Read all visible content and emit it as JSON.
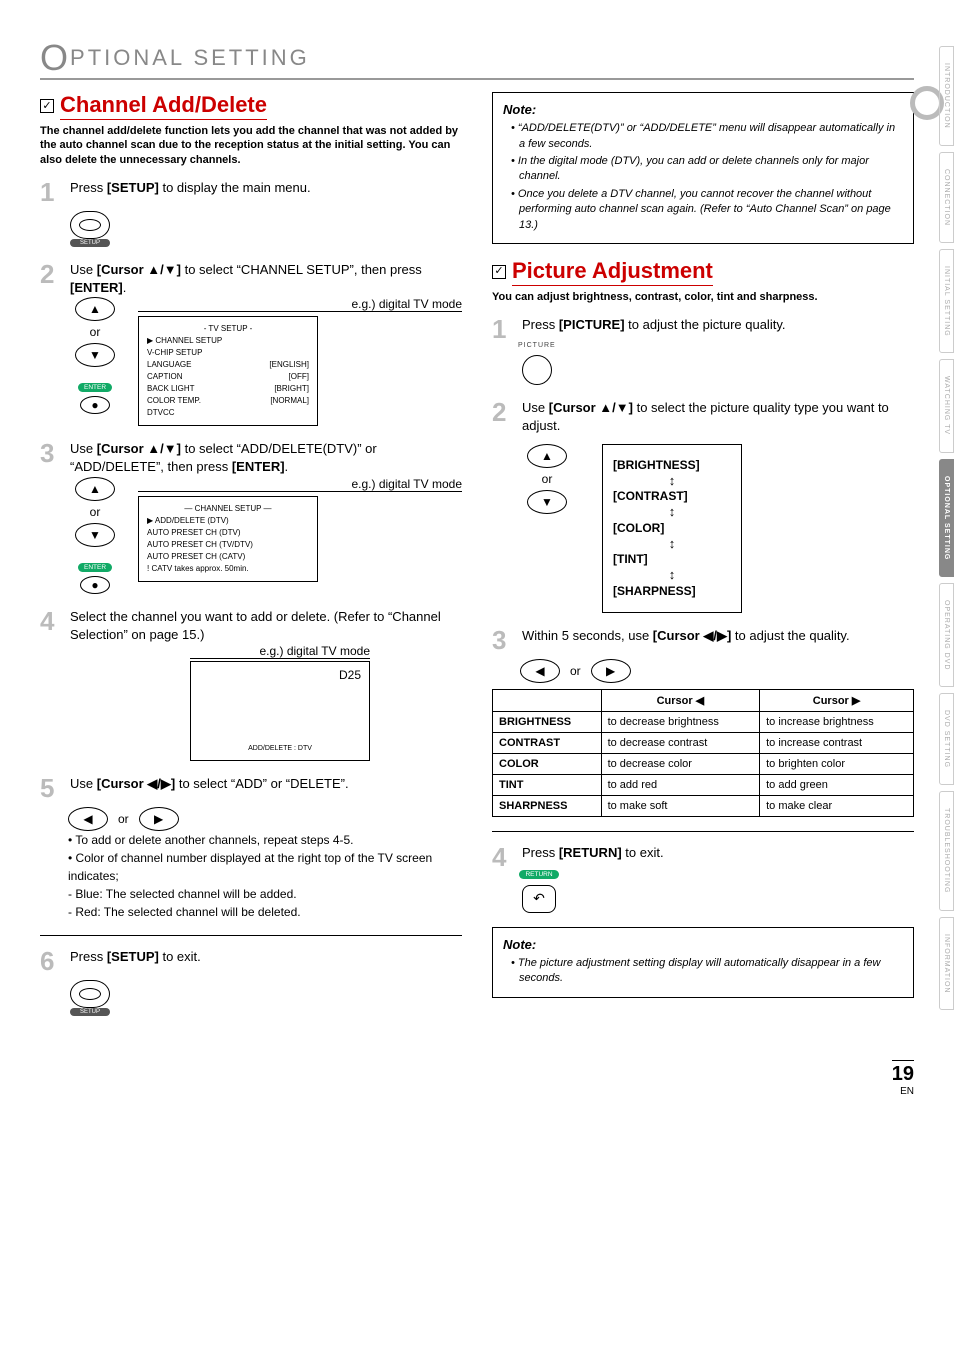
{
  "header": {
    "prefix": "O",
    "title": "PTIONAL  SETTING"
  },
  "sideTabs": [
    "INTRODUCTION",
    "CONNECTION",
    "INITIAL  SETTING",
    "WATCHING  TV",
    "OPTIONAL  SETTING",
    "OPERATING  DVD",
    "DVD  SETTING",
    "TROUBLESHOOTING",
    "INFORMATION"
  ],
  "activeTabIndex": 4,
  "channel": {
    "heading": "Channel Add/Delete",
    "intro": "The channel add/delete function lets you add the channel that was not added by the auto channel scan due to the reception status at the initial setting. You can also delete the unnecessary channels.",
    "step1": {
      "pre": "Press ",
      "btn": "[SETUP]",
      "post": " to display the main menu."
    },
    "setupLabel": "SETUP",
    "step2": {
      "pre": "Use ",
      "btn": "[Cursor ▲/▼]",
      "mid": " to select “CHANNEL SETUP”, then press ",
      "btn2": "[ENTER]",
      "post": "."
    },
    "or": "or",
    "enterLabel": "ENTER",
    "egLabel": "e.g.) digital TV mode",
    "menu1": {
      "title": "-   TV SETUP   -",
      "rows": [
        [
          "▶ CHANNEL SETUP",
          ""
        ],
        [
          "V-CHIP SETUP",
          ""
        ],
        [
          "LANGUAGE",
          "[ENGLISH]"
        ],
        [
          "CAPTION",
          "[OFF]"
        ],
        [
          "BACK LIGHT",
          "[BRIGHT]"
        ],
        [
          "COLOR TEMP.",
          "[NORMAL]"
        ],
        [
          "DTVCC",
          ""
        ]
      ]
    },
    "step3": {
      "pre": "Use ",
      "btn": "[Cursor ▲/▼]",
      "mid": " to select “ADD/DELETE(DTV)” or “ADD/DELETE”, then press ",
      "btn2": "[ENTER]",
      "post": "."
    },
    "menu2": {
      "title": "—  CHANNEL SETUP  —",
      "rows": [
        [
          "▶ ADD/DELETE (DTV)"
        ],
        [
          "AUTO PRESET CH (DTV)"
        ],
        [
          "AUTO PRESET CH (TV/DTV)"
        ],
        [
          "AUTO PRESET CH (CATV)"
        ],
        [
          "! CATV takes approx. 50min."
        ]
      ]
    },
    "step4": "Select the channel you want to add or delete. (Refer to “Channel Selection” on page 15.)",
    "screen": {
      "ch": "D25",
      "lbl": "ADD/DELETE : DTV"
    },
    "step5": {
      "pre": "Use ",
      "btn": "[Cursor ◀/▶]",
      "post": " to select “ADD” or “DELETE”."
    },
    "bullets": [
      "• To add or delete another channels, repeat steps 4-5.",
      "• Color of channel number displayed at the right top of the TV screen indicates;",
      "- Blue:  The selected channel will be added.",
      "- Red:   The selected channel will be deleted."
    ],
    "step6": {
      "pre": "Press ",
      "btn": "[SETUP]",
      "post": " to exit."
    }
  },
  "note1": {
    "heading": "Note:",
    "items": [
      "• “ADD/DELETE(DTV)” or “ADD/DELETE” menu will disappear automatically in a few seconds.",
      "• In the digital mode (DTV), you can add or delete channels only for major channel.",
      "• Once you delete a DTV channel, you cannot recover the channel without performing auto channel scan again. (Refer to “Auto Channel Scan” on page 13.)"
    ]
  },
  "picture": {
    "heading": "Picture Adjustment",
    "intro": "You can adjust brightness, contrast, color, tint and sharpness.",
    "step1": {
      "pre": "Press ",
      "btn": "[PICTURE]",
      "post": " to adjust the picture quality."
    },
    "pictureLabel": "PICTURE",
    "step2": {
      "pre": "Use ",
      "btn": "[Cursor ▲/▼]",
      "post": " to select the picture quality type you want to adjust."
    },
    "options": [
      "[BRIGHTNESS]",
      "[CONTRAST]",
      "[COLOR]",
      "[TINT]",
      "[SHARPNESS]"
    ],
    "step3": {
      "pre": "Within 5 seconds, use ",
      "btn": "[Cursor ◀/▶]",
      "post": " to adjust the quality."
    },
    "tableHead": [
      "",
      "Cursor ◀",
      "Cursor ▶"
    ],
    "tableRows": [
      [
        "BRIGHTNESS",
        "to decrease brightness",
        "to increase brightness"
      ],
      [
        "CONTRAST",
        "to decrease contrast",
        "to increase contrast"
      ],
      [
        "COLOR",
        "to decrease color",
        "to brighten color"
      ],
      [
        "TINT",
        "to add red",
        "to add green"
      ],
      [
        "SHARPNESS",
        "to make soft",
        "to make clear"
      ]
    ],
    "step4": {
      "pre": "Press ",
      "btn": "[RETURN]",
      "post": " to exit."
    },
    "returnLabel": "RETURN"
  },
  "note2": {
    "heading": "Note:",
    "items": [
      "• The picture adjustment setting display will automatically disappear in a few seconds."
    ]
  },
  "footer": {
    "page": "19",
    "en": "EN"
  }
}
